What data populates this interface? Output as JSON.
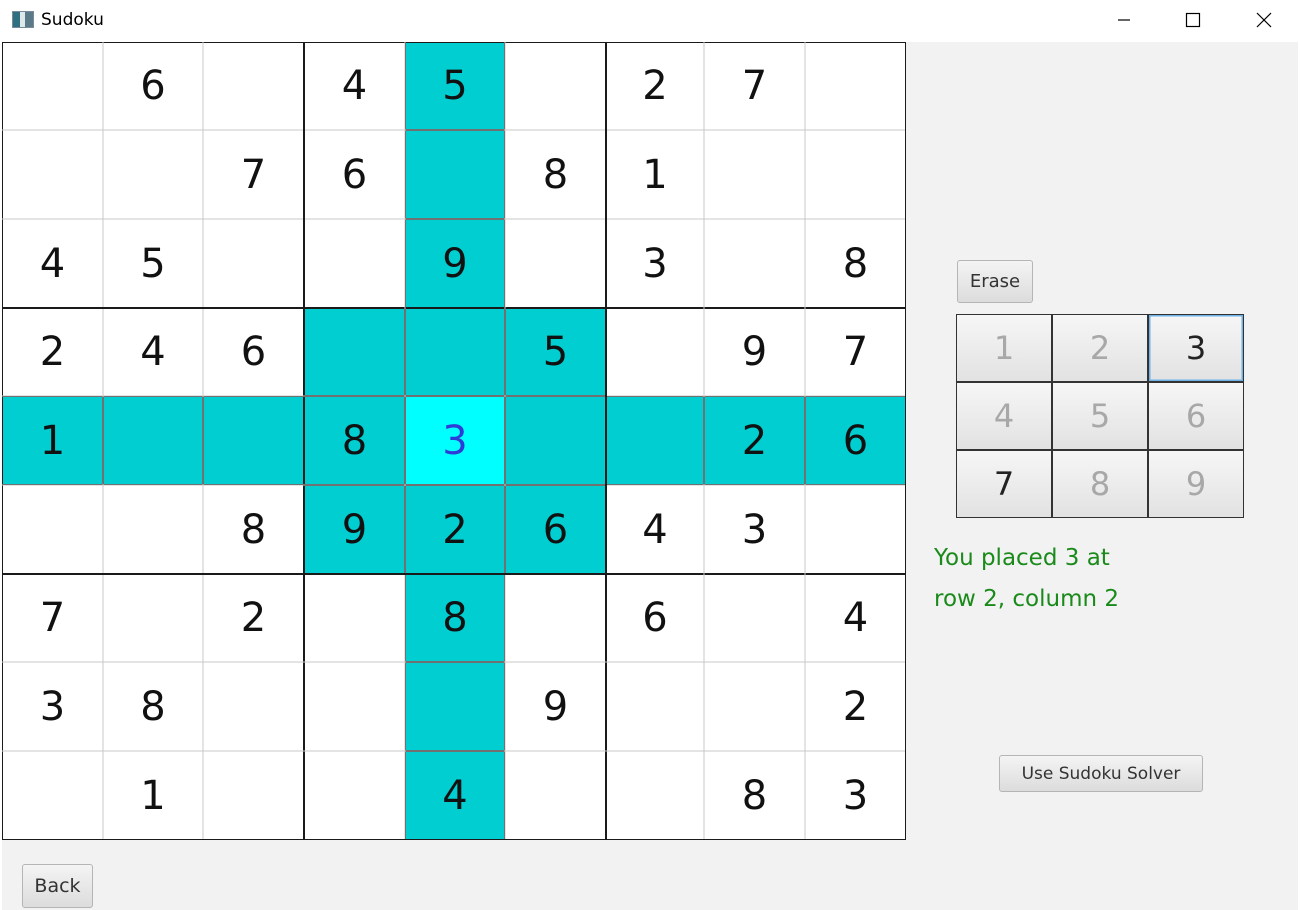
{
  "window": {
    "title": "Sudoku"
  },
  "board": {
    "cells": [
      [
        "",
        "6",
        "",
        "4",
        "5",
        "",
        "2",
        "7",
        ""
      ],
      [
        "",
        "",
        "7",
        "6",
        "",
        "8",
        "1",
        "",
        ""
      ],
      [
        "4",
        "5",
        "",
        "",
        "9",
        "",
        "3",
        "",
        "8"
      ],
      [
        "2",
        "4",
        "6",
        "",
        "",
        "5",
        "",
        "9",
        "7"
      ],
      [
        "1",
        "",
        "",
        "8",
        "3",
        "",
        "",
        "2",
        "6"
      ],
      [
        "",
        "",
        "8",
        "9",
        "2",
        "6",
        "4",
        "3",
        ""
      ],
      [
        "7",
        "",
        "2",
        "",
        "8",
        "",
        "6",
        "",
        "4"
      ],
      [
        "3",
        "8",
        "",
        "",
        "",
        "9",
        "",
        "",
        "2"
      ],
      [
        "",
        "1",
        "",
        "",
        "4",
        "",
        "",
        "8",
        "3"
      ]
    ],
    "selected": {
      "row": 4,
      "col": 4
    },
    "colors": {
      "highlight": "#00ced1",
      "selected": "#00ffff",
      "selected_text": "#2f3bd6"
    }
  },
  "controls": {
    "erase_label": "Erase",
    "solver_label": "Use Sudoku Solver",
    "back_label": "Back",
    "numbers": [
      {
        "label": "1",
        "enabled": false
      },
      {
        "label": "2",
        "enabled": false
      },
      {
        "label": "3",
        "enabled": true,
        "focused": true
      },
      {
        "label": "4",
        "enabled": false
      },
      {
        "label": "5",
        "enabled": false
      },
      {
        "label": "6",
        "enabled": false
      },
      {
        "label": "7",
        "enabled": true
      },
      {
        "label": "8",
        "enabled": false
      },
      {
        "label": "9",
        "enabled": false
      }
    ]
  },
  "status": {
    "line1": "You placed 3 at",
    "line2": "row 2, column 2",
    "color": "#1a8a1a"
  }
}
